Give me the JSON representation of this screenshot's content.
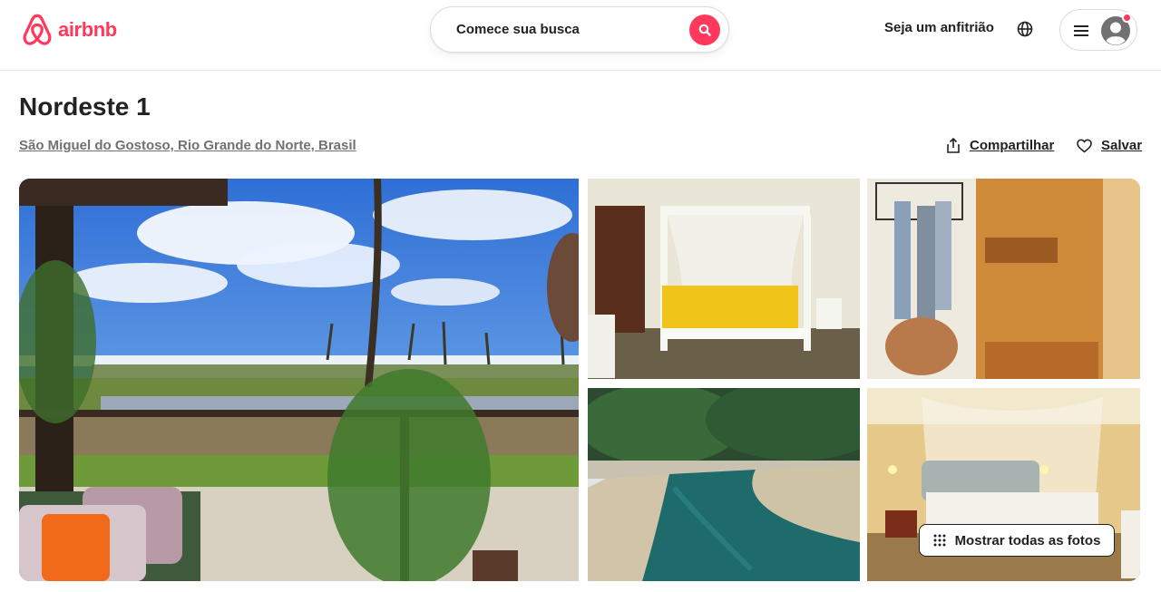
{
  "header": {
    "logo_text": "airbnb",
    "search_label": "Comece sua busca",
    "host_link": "Seja um anfitrião",
    "icons": [
      "airbnb-logo-icon",
      "search-icon",
      "globe-icon",
      "hamburger-menu-icon",
      "user-avatar-icon"
    ],
    "brand_color": "#FF385C"
  },
  "listing": {
    "title": "Nordeste 1",
    "location": "São Miguel do Gostoso, Rio Grande do Norte, Brasil",
    "share_label": "Compartilhar",
    "save_label": "Salvar"
  },
  "gallery": {
    "show_all_label": "Mostrar todas as fotos",
    "photos": [
      "veranda-ocean-view",
      "canopy-bedroom",
      "bathroom-shower",
      "pool",
      "bedroom-mosquito-net"
    ]
  }
}
